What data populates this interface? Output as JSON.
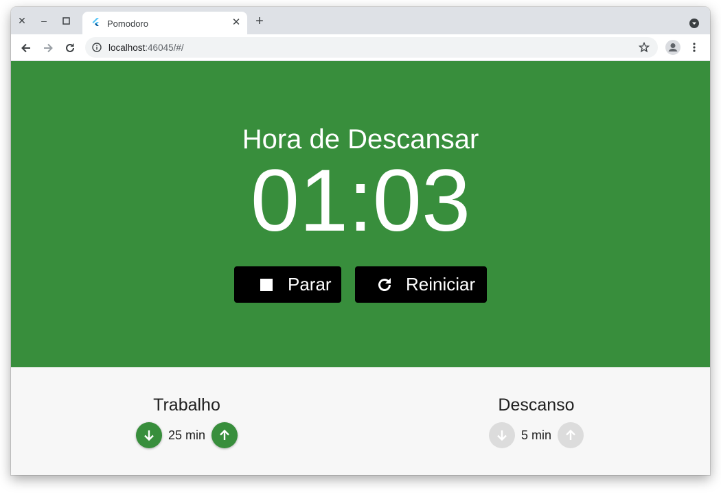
{
  "browser": {
    "tab_title": "Pomodoro",
    "url_host": "localhost",
    "url_rest": ":46045/#/"
  },
  "app": {
    "status": "Hora de Descansar",
    "timer": "01:03",
    "stop_label": "Parar",
    "restart_label": "Reiniciar",
    "accent_color": "#388e3c",
    "settings": {
      "work": {
        "label": "Trabalho",
        "value": "25 min",
        "enabled": true
      },
      "rest": {
        "label": "Descanso",
        "value": "5 min",
        "enabled": false
      }
    }
  }
}
